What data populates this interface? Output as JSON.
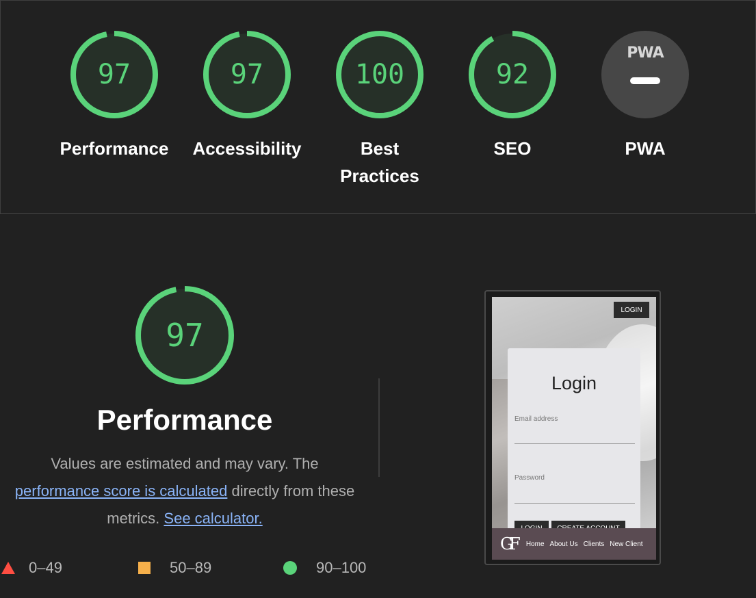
{
  "colors": {
    "pass": "#5ad37a",
    "average": "#f6b04b",
    "fail": "#ff4e42",
    "background": "#212121"
  },
  "categories": [
    {
      "id": "performance",
      "score": 97,
      "label": "Performance"
    },
    {
      "id": "accessibility",
      "score": 97,
      "label": "Accessibility"
    },
    {
      "id": "best-practices",
      "score": 100,
      "label": "Best Practices"
    },
    {
      "id": "seo",
      "score": 92,
      "label": "SEO"
    },
    {
      "id": "pwa",
      "badge_text": "PWA",
      "label": "PWA",
      "icon": "pwa-dash-icon"
    }
  ],
  "detail": {
    "score": 97,
    "title": "Performance",
    "desc_prefix": "Values are estimated and may vary. The ",
    "desc_link": "performance score is calculated",
    "desc_middle": " directly from these metrics. ",
    "calc_link": "See calculator."
  },
  "legend": {
    "fail": "0–49",
    "average": "50–89",
    "pass": "90–100"
  },
  "screenshot": {
    "login_button": "LOGIN",
    "card_title": "Login",
    "email_label": "Email address",
    "password_label": "Password",
    "submit_button": "LOGIN",
    "create_button": "CREATE ACCOUNT",
    "logo": "GF",
    "nav": [
      "Home",
      "About Us",
      "Clients",
      "New Client"
    ]
  }
}
